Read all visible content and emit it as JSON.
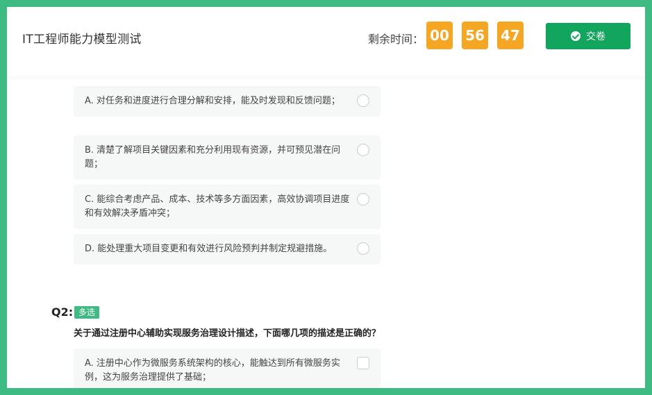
{
  "header": {
    "title": "IT工程师能力模型测试",
    "timer_label": "剩余时间：",
    "timer": {
      "hours": "00",
      "minutes": "56",
      "seconds": "47"
    },
    "submit_label": "交卷"
  },
  "q1": {
    "options": [
      {
        "label": "A. 对任务和进度进行合理分解和安排，能及时发现和反馈问题；"
      },
      {
        "label": "B. 清楚了解项目关键因素和充分利用现有资源，并可预见潜在问题；"
      },
      {
        "label": "C. 能综合考虑产品、成本、技术等多方面因素，高效协调项目进度和有效解决矛盾冲突；"
      },
      {
        "label": "D. 能处理重大项目变更和有效进行风险预判并制定规避措施。"
      }
    ]
  },
  "q2": {
    "number": "Q2:",
    "type_badge": "多选",
    "text": "关于通过注册中心辅助实现服务治理设计描述，下面哪几项的描述是正确的？",
    "options": [
      {
        "label": "A. 注册中心作为微服务系统架构的核心，能触达到所有微服务实例，这为服务治理提供了基础；"
      }
    ]
  },
  "colors": {
    "border_green": "#3dbb82",
    "submit_green": "#11a55d",
    "timer_orange": "#f5a623"
  }
}
